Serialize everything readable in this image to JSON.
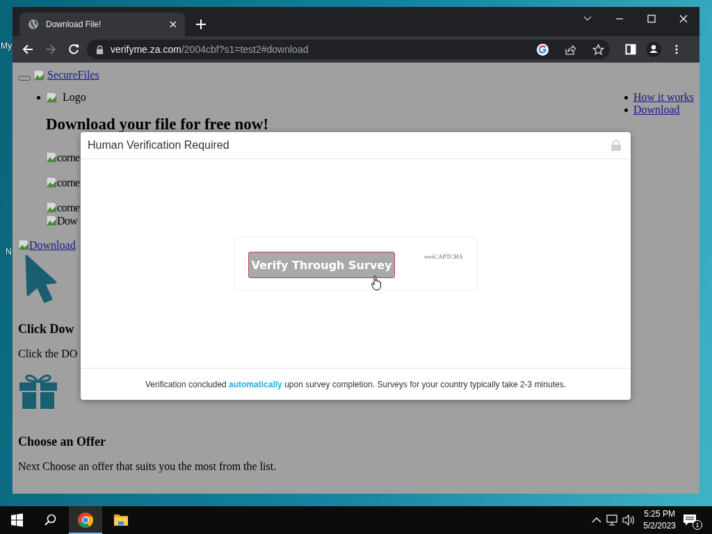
{
  "desktop": {
    "icon_labels": [
      "My",
      "N"
    ]
  },
  "browser": {
    "tab": {
      "title": "Download File!",
      "selected": true
    },
    "url": {
      "host": "verifyme.za.com",
      "path": "/2004cbf?s1=test2#download"
    },
    "forward_disabled": true
  },
  "page": {
    "brand_link": "SecureFiles",
    "logo_alt": "Logo",
    "nav": [
      "How it works",
      "Download"
    ],
    "heading": "Download your file for free now!",
    "images": [
      "corne",
      "corne",
      "corne",
      "Dow"
    ],
    "download_link": "Download",
    "step1_title": "Click Dow",
    "step1_text": "Click the DO",
    "step2_title": "Choose an Offer",
    "step2_text": "Next Choose an offer that suits you the most from the list."
  },
  "modal": {
    "title": "Human Verification Required",
    "button": "Verify Through Survey",
    "brand": "veriCAPTCHA",
    "footer": "Verification concluded **automatically** upon survey completion. Surveys for your country typically take 2-3 minutes."
  },
  "taskbar": {
    "apps": [
      {
        "kind": "chrome",
        "selected": true
      },
      {
        "kind": "explorer",
        "selected": false
      }
    ],
    "time": "5:25 PM",
    "date": "5/2/2023",
    "notifications": "1"
  }
}
